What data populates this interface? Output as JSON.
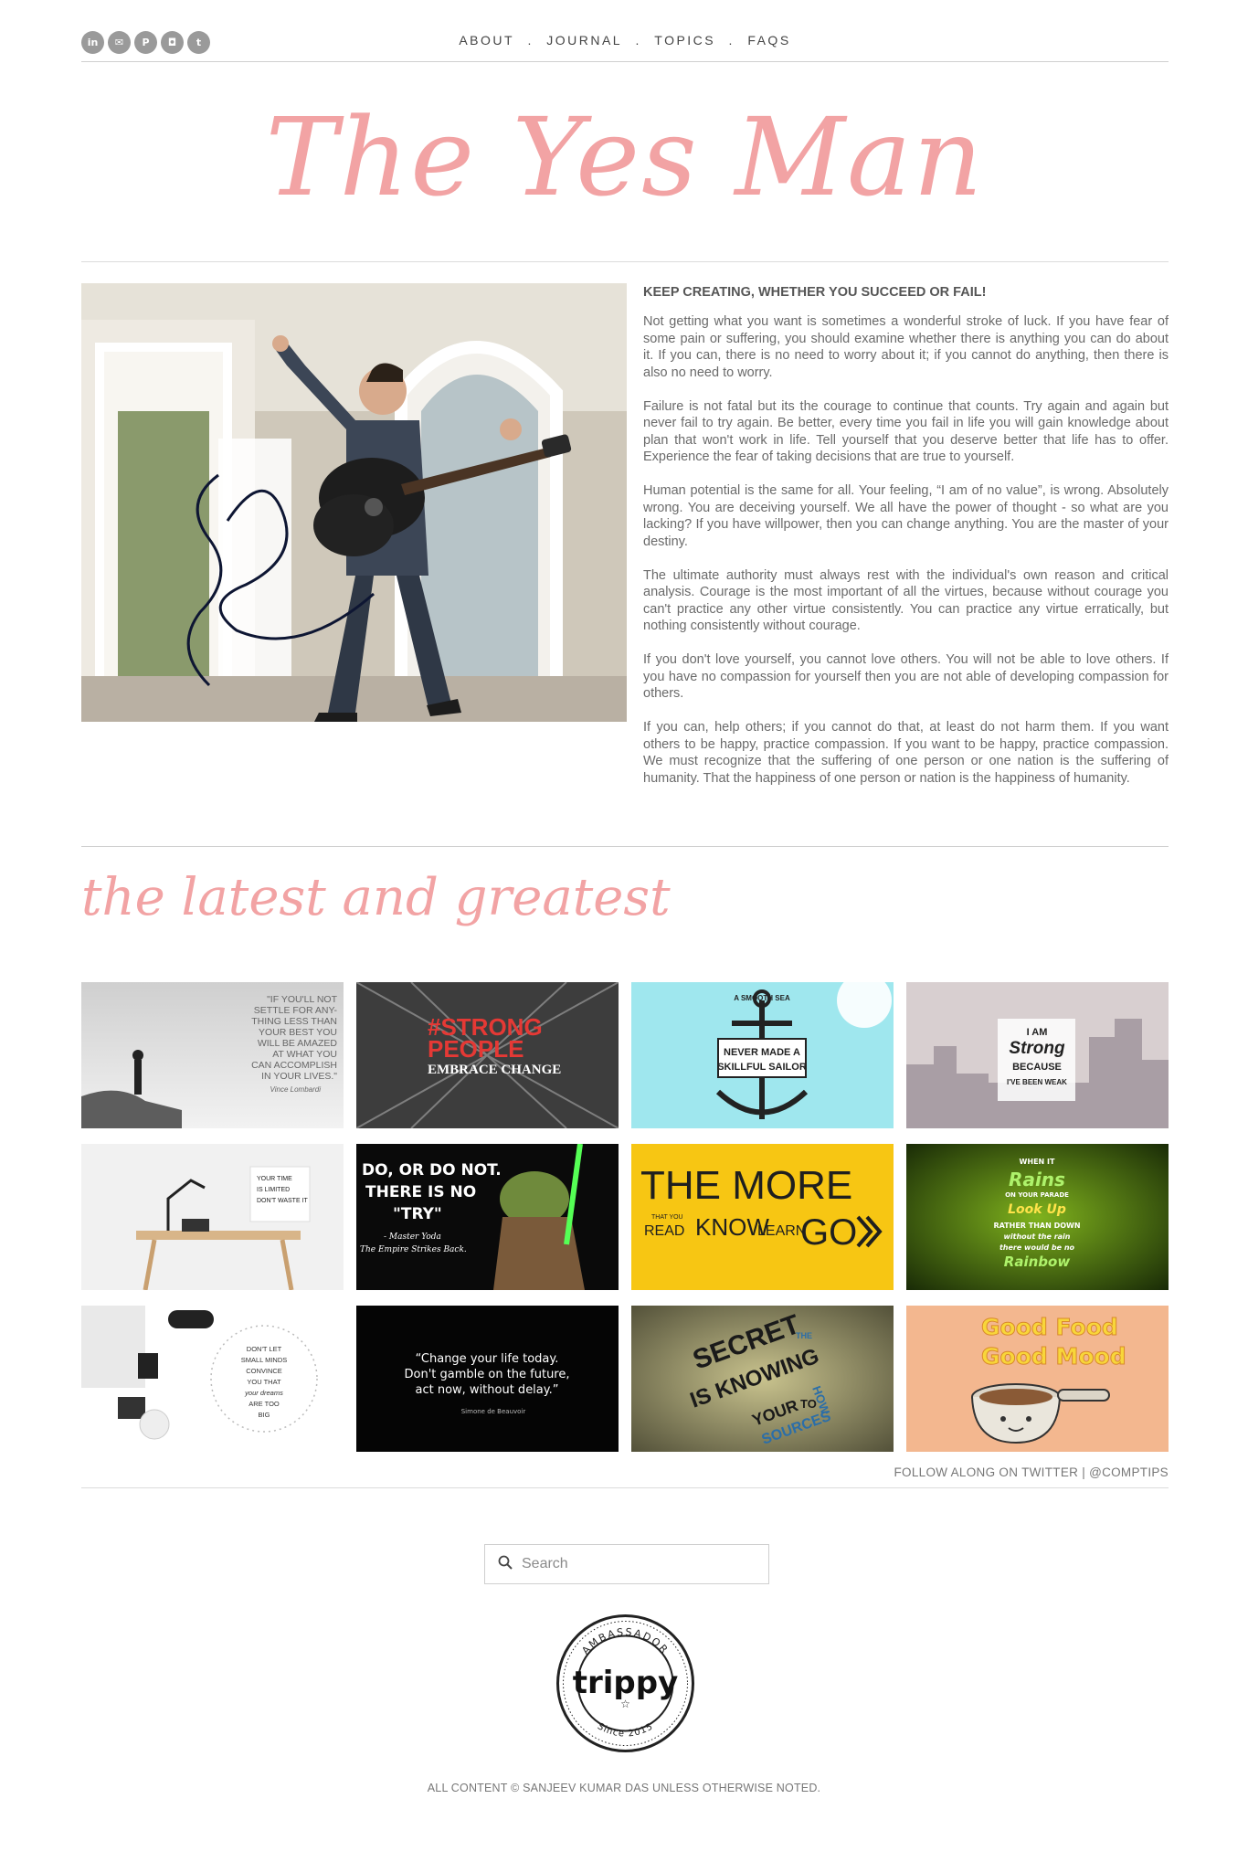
{
  "header": {
    "social": [
      {
        "name": "linkedin-icon",
        "glyph": "in"
      },
      {
        "name": "email-icon",
        "glyph": "✉"
      },
      {
        "name": "pinterest-icon",
        "glyph": "P"
      },
      {
        "name": "instagram-icon",
        "glyph": "◘"
      },
      {
        "name": "twitter-icon",
        "glyph": "t"
      }
    ],
    "nav": [
      "ABOUT",
      "JOURNAL",
      "TOPICS",
      "FAQS"
    ],
    "nav_sep": "."
  },
  "site_title": "The Yes Man",
  "post": {
    "heading": "KEEP CREATING, WHETHER YOU SUCCEED OR FAIL!",
    "paragraphs": [
      "Not getting what you want is sometimes a wonderful stroke of luck. If you have fear of some pain or suffering, you should examine whether there is anything you can do about it. If you can, there is no need to worry about it; if you cannot do anything, then there is also no need to worry.",
      "Failure is not fatal but its the courage to continue that counts. Try again and again but never fail to try again. Be better, every time you fail in life you will gain knowledge about plan that won't work in life. Tell yourself that you deserve better that life has to offer. Experience the fear of taking decisions that are true to yourself.",
      "Human potential is the same for all. Your feeling, “I am of no value”, is wrong. Absolutely wrong. You are deceiving yourself. We all have the power of thought - so what are you lacking? If you have willpower, then you can change anything. You are the master of your destiny.",
      "The ultimate authority must always rest with the individual's own reason and critical analysis. Courage is the most important of all the virtues, because without courage you can't practice any other virtue consistently. You can practice any virtue erratically, but nothing consistently without courage.",
      "If you don't love yourself, you cannot love others. You will not be able to love others. If you have no compassion for yourself then you are not able of developing compassion for others.",
      "If you can, help others; if you cannot do that, at least do not harm them. If you want others to be happy, practice compassion. If you want to be happy, practice compassion. We must recognize that the suffering of one person or one nation is the suffering of humanity. That the happiness of one person or nation is the happiness of humanity."
    ]
  },
  "latest": {
    "title": "the latest and greatest",
    "tiles": [
      {
        "text": [
          "\"IF YOU'LL NOT",
          "SETTLE FOR ANY-",
          "THING LESS THAN",
          "YOUR BEST YOU",
          "WILL BE AMAZED",
          "AT WHAT YOU",
          "CAN ACCOMPLISH",
          "IN YOUR LIVES.\"",
          "Vince Lombardi"
        ]
      },
      {
        "text": [
          "#STRONG",
          "PEOPLE",
          "EMBRACE CHANGE"
        ]
      },
      {
        "text": [
          "A SMOOTH SEA",
          "NEVER MADE A",
          "SKILLFUL SAILOR"
        ]
      },
      {
        "text": [
          "I AM",
          "Strong",
          "BECAUSE",
          "I'VE BEEN WEAK"
        ]
      },
      {
        "text": [
          "YOUR TIME",
          "IS LIMITED",
          "DON'T WASTE IT"
        ]
      },
      {
        "text": [
          "DO, OR DO NOT.",
          "THERE IS NO",
          "\"TRY\"",
          "- Master Yoda",
          "The Empire Strikes Back."
        ]
      },
      {
        "text": [
          "THE MORE",
          "THAT YOU",
          "READ",
          "KNOW",
          "LEARN",
          "GO"
        ]
      },
      {
        "text": [
          "WHEN IT",
          "Rains",
          "ON YOUR PARADE",
          "Look Up",
          "RATHER THAN DOWN",
          "without the rain",
          "there would be no",
          "Rainbow"
        ]
      },
      {
        "text": [
          "DON'T LET",
          "SMALL MINDS",
          "CONVINCE",
          "YOU THAT",
          "your dreams",
          "ARE TOO",
          "BIG"
        ]
      },
      {
        "text": [
          "“Change your life today.",
          "Don't gamble on the future,",
          "act now, without delay.”",
          "Simone de Beauvoir"
        ]
      },
      {
        "text": [
          "SECRET",
          "IS KNOWING",
          "THE",
          "YOUR",
          "SOURCES",
          "TO",
          "HOW"
        ]
      },
      {
        "text": [
          "Good Food",
          "Good Mood"
        ]
      }
    ],
    "follow": "FOLLOW ALONG ON TWITTER | @COMPTIPS"
  },
  "search": {
    "placeholder": "Search"
  },
  "badge": {
    "top": "AMBASSADOR",
    "brand": "trippy",
    "bottom": "Since 2015"
  },
  "footer": {
    "copyright": "ALL CONTENT © SANJEEV KUMAR DAS UNLESS OTHERWISE NOTED."
  },
  "colors": {
    "accent": "#f2a3a4",
    "text": "#6a6a6a",
    "rule": "#dcdcdc"
  }
}
